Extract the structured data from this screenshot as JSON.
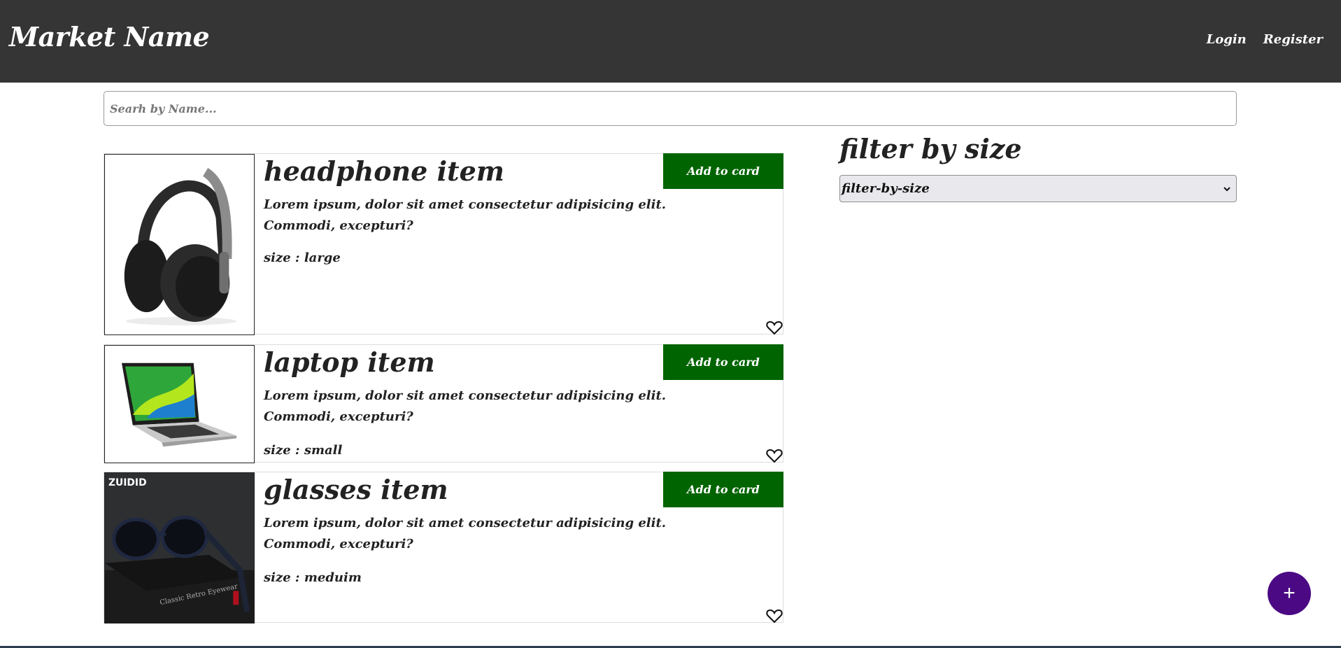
{
  "header": {
    "brand": "Market Name",
    "login": "Login",
    "register": "Register"
  },
  "search": {
    "placeholder": "Searh by Name..."
  },
  "products": [
    {
      "title": "headphone item",
      "description": "Lorem ipsum, dolor sit amet consectetur adipisicing elit. Commodi, excepturi?",
      "size": "size : large",
      "button": "Add to card",
      "image_icon": "headphones-image"
    },
    {
      "title": "laptop item",
      "description": "Lorem ipsum, dolor sit amet consectetur adipisicing elit. Commodi, excepturi?",
      "size": "size : small",
      "button": "Add to card",
      "image_icon": "laptop-image"
    },
    {
      "title": "glasses item",
      "description": "Lorem ipsum, dolor sit amet consectetur adipisicing elit. Commodi, excepturi?",
      "size": "size : meduim",
      "button": "Add to card",
      "image_icon": "sunglasses-image",
      "image_text": "ZUIDID"
    }
  ],
  "filter": {
    "title": "filter by size",
    "selected": "filter-by-size"
  },
  "fab": {
    "label": "+"
  },
  "colors": {
    "header_bg": "#353535",
    "button_bg": "#006400",
    "fab_bg": "#4b0a84"
  }
}
